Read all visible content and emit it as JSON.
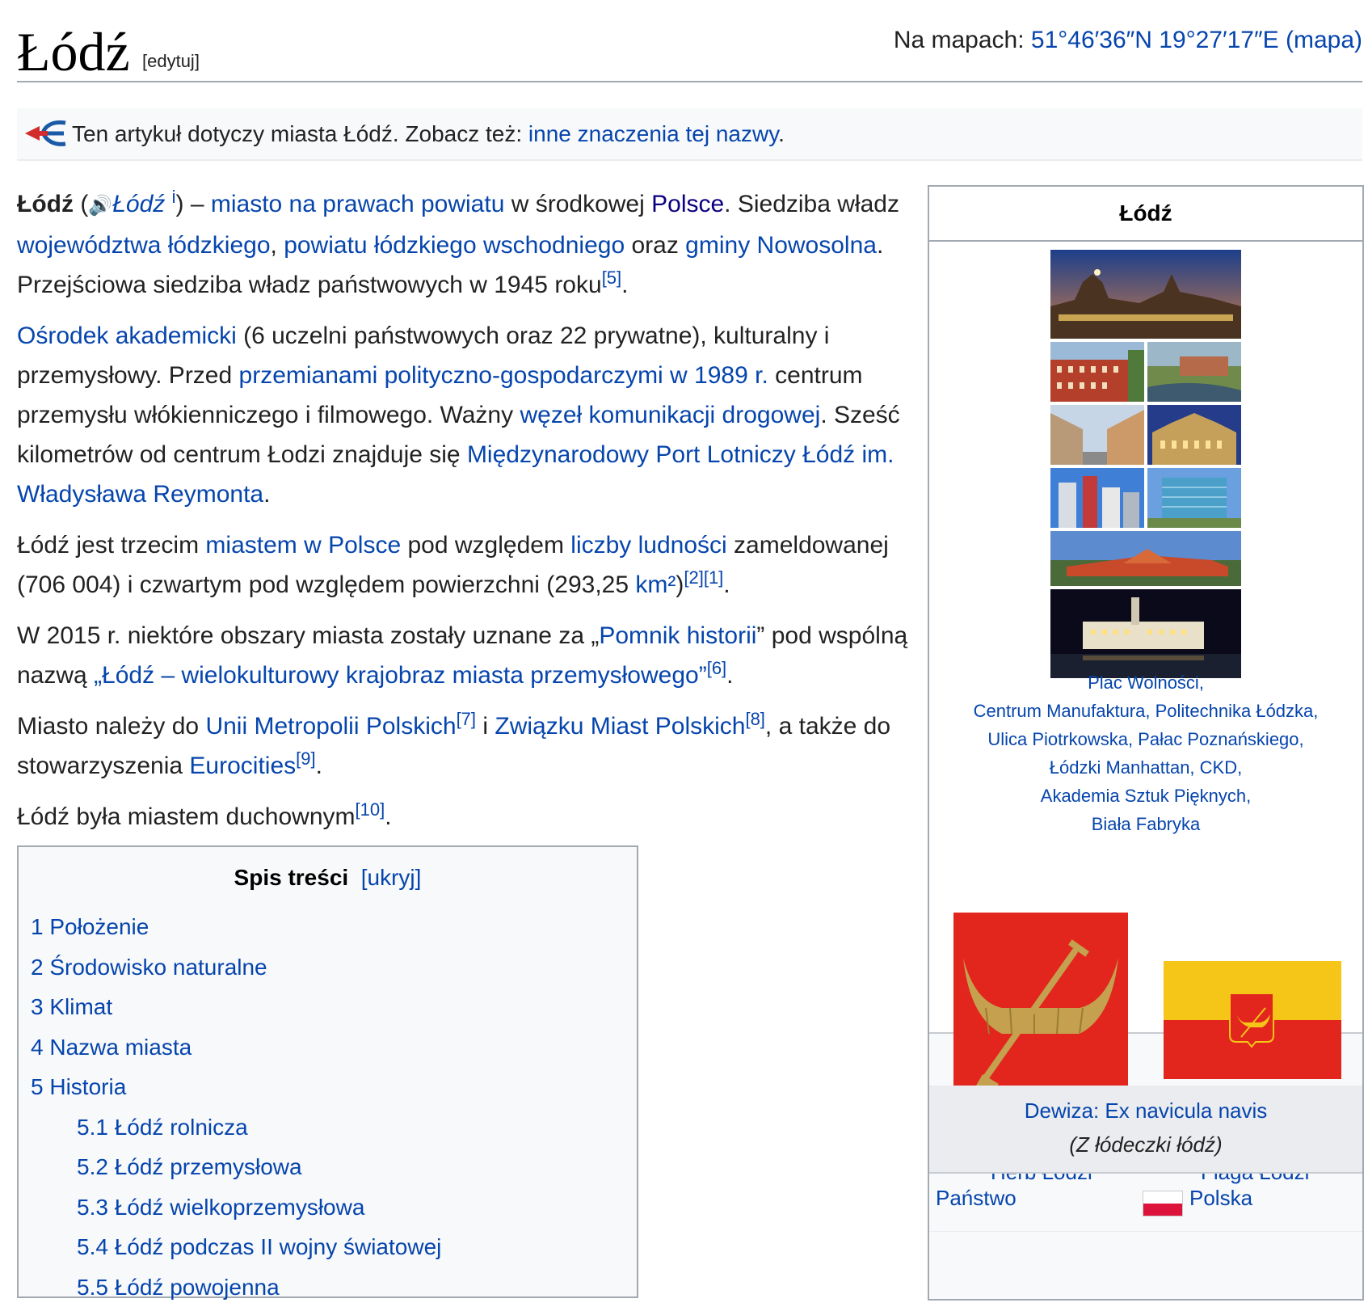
{
  "header": {
    "title": "Łódź",
    "edit_label": "[edytuj]",
    "coords_prefix": "Na mapach: ",
    "coords_link": "51°46′36″N 19°27′17″E",
    "coords_map": "(mapa)"
  },
  "hatnote": {
    "text": "Ten artykuł dotyczy miasta Łódź. Zobacz też: ",
    "link": "inne znaczenia tej nazwy",
    "end": "."
  },
  "intro": {
    "p1": {
      "bold": "Łódź",
      "open": " (",
      "audio": "Łódź",
      "audio_sup": "i",
      "close": ") – ",
      "l1": "miasto na prawach powiatu",
      "t1": " w środkowej ",
      "l2": "Polsce",
      "t2": ". Siedziba władz ",
      "l3": "województwa łódzkiego",
      "t3": ", ",
      "l4": "powiatu łódzkiego wschodniego",
      "t4": " oraz ",
      "l5": "gminy Nowosolna",
      "t5": ". Przejściowa siedziba władz państwowych w 1945 roku",
      "ref": "[5]",
      "end": "."
    },
    "p2": {
      "l1": "Ośrodek akademicki",
      "t1": " (6 uczelni państwowych oraz 22 prywatne), kulturalny i przemysłowy. Przed ",
      "l2": "przemianami polityczno-gospodarczymi w 1989 r.",
      "t2": " centrum przemysłu włókienniczego i filmowego. Ważny ",
      "l3": "węzeł komunikacji drogowej",
      "t3": ". Sześć kilometrów od centrum Łodzi znajduje się ",
      "l4": "Międzynarodowy Port Lotniczy Łódź im. Władysława Reymonta",
      "end": "."
    },
    "p3": {
      "t1": "Łódź jest trzecim ",
      "l1": "miastem w Polsce",
      "t2": " pod względem ",
      "l2": "liczby ludności",
      "t3": " zameldowanej (706 004) i czwartym pod względem powierzchni (293,25 ",
      "l3": "km²",
      "t4": ")",
      "ref1": "[2]",
      "ref2": "[1]",
      "end": "."
    },
    "p4": {
      "t1": "W 2015 r. niektóre obszary miasta zostały uznane za „",
      "l1": "Pomnik historii",
      "t2": "” pod wspólną nazwą ",
      "l2": "„Łódź – wielokulturowy krajobraz miasta przemysłowego”",
      "ref": "[6]",
      "end": "."
    },
    "p5": {
      "t1": "Miasto należy do ",
      "l1": "Unii Metropolii Polskich",
      "ref1": "[7]",
      "t2": " i ",
      "l2": "Związku Miast Polskich",
      "ref2": "[8]",
      "t3": ", a także do stowarzyszenia ",
      "l3": "Eurocities",
      "ref3": "[9]",
      "end": "."
    },
    "p6": {
      "t1": "Łódź była miastem duchownym",
      "ref": "[10]",
      "end": "."
    }
  },
  "toc": {
    "title": "Spis treści",
    "toggle": "[ukryj]",
    "items": [
      {
        "num": "1",
        "label": "Położenie"
      },
      {
        "num": "2",
        "label": "Środowisko naturalne"
      },
      {
        "num": "3",
        "label": "Klimat"
      },
      {
        "num": "4",
        "label": "Nazwa miasta"
      },
      {
        "num": "5",
        "label": "Historia"
      },
      {
        "num": "5.1",
        "label": "Łódź rolnicza"
      },
      {
        "num": "5.2",
        "label": "Łódź przemysłowa"
      },
      {
        "num": "5.3",
        "label": "Łódź wielkoprzemysłowa"
      },
      {
        "num": "5.4",
        "label": "Łódź podczas II wojny światowej"
      },
      {
        "num": "5.5",
        "label": "Łódź powojenna"
      }
    ]
  },
  "infobox": {
    "title": "Łódź",
    "captions": [
      "Plac Wolności,",
      "Centrum Manufaktura, Politechnika Łódzka,",
      "Ulica Piotrkowska, Pałac Poznańskiego,",
      "Łódzki Manhattan, CKD,",
      "Akademia Sztuk Pięknych,",
      "Biała Fabryka"
    ],
    "herb_label": "Herb Łodzi",
    "flag_label": "Flaga Łodzi",
    "motto_line1": "Dewiza: Ex navicula navis",
    "motto_line2": "(Z łódeczki łódź)",
    "rows": [
      {
        "label": "Państwo",
        "value": "Polska"
      }
    ]
  },
  "colors": {
    "link": "#0645ad",
    "visited_link": "#0b0080",
    "herb_red": "#e2261d",
    "boat_gold": "#c4a04f",
    "flag_yellow": "#f5c518",
    "flag_red": "#e2261d"
  }
}
